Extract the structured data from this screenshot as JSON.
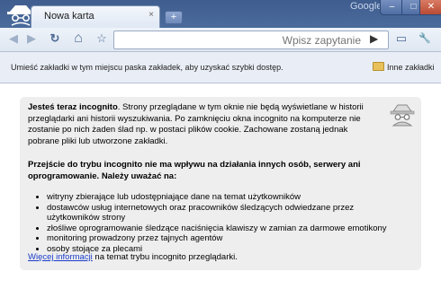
{
  "window": {
    "brand_label": "Google",
    "buttons": {
      "minimize": "–",
      "maximize": "□",
      "close": "✕"
    }
  },
  "tab": {
    "title": "Nowa karta",
    "close": "×",
    "new_tab": "+"
  },
  "toolbar": {
    "back_icon": "◀",
    "forward_icon": "▶",
    "reload_icon": "↻",
    "home_icon": "⌂",
    "star_icon": "☆",
    "omnibox_placeholder": "Wpisz zapytanie",
    "go_icon": "▶",
    "page_menu_icon": "▭",
    "wrench_icon": "🔧"
  },
  "bookmarks_bar": {
    "hint": "Umieść zakładki w tym miejscu paska zakładek, aby uzyskać szybki dostęp.",
    "other_bookmarks": "Inne zakładki"
  },
  "incognito": {
    "heading_bold": "Jesteś teraz incognito",
    "heading_rest": ". Strony przeglądane w tym oknie nie będą wyświetlane w historii przeglądarki ani historii wyszukiwania. Po zamknięciu okna incognito na komputerze nie zostanie po nich żaden ślad np. w postaci plików cookie. Zachowane zostaną jednak pobrane pliki lub utworzone zakładki.",
    "warning": "Przejście do trybu incognito nie ma wpływu na działania innych osób, serwery ani oprogramowanie. Należy uważać na:",
    "bullets": [
      "witryny zbierające lub udostępniające dane na temat użytkowników",
      "dostawców usług internetowych oraz pracowników śledzących odwiedzane przez użytkowników strony",
      "złośliwe oprogramowanie śledzące naciśnięcia klawiszy w zamian za darmowe emotikony",
      "monitoring prowadzony przez tajnych agentów",
      "osoby stojące za plecami"
    ],
    "more_info_link": "Więcej informacji",
    "more_info_rest": " na temat trybu incognito przeglądarki."
  }
}
